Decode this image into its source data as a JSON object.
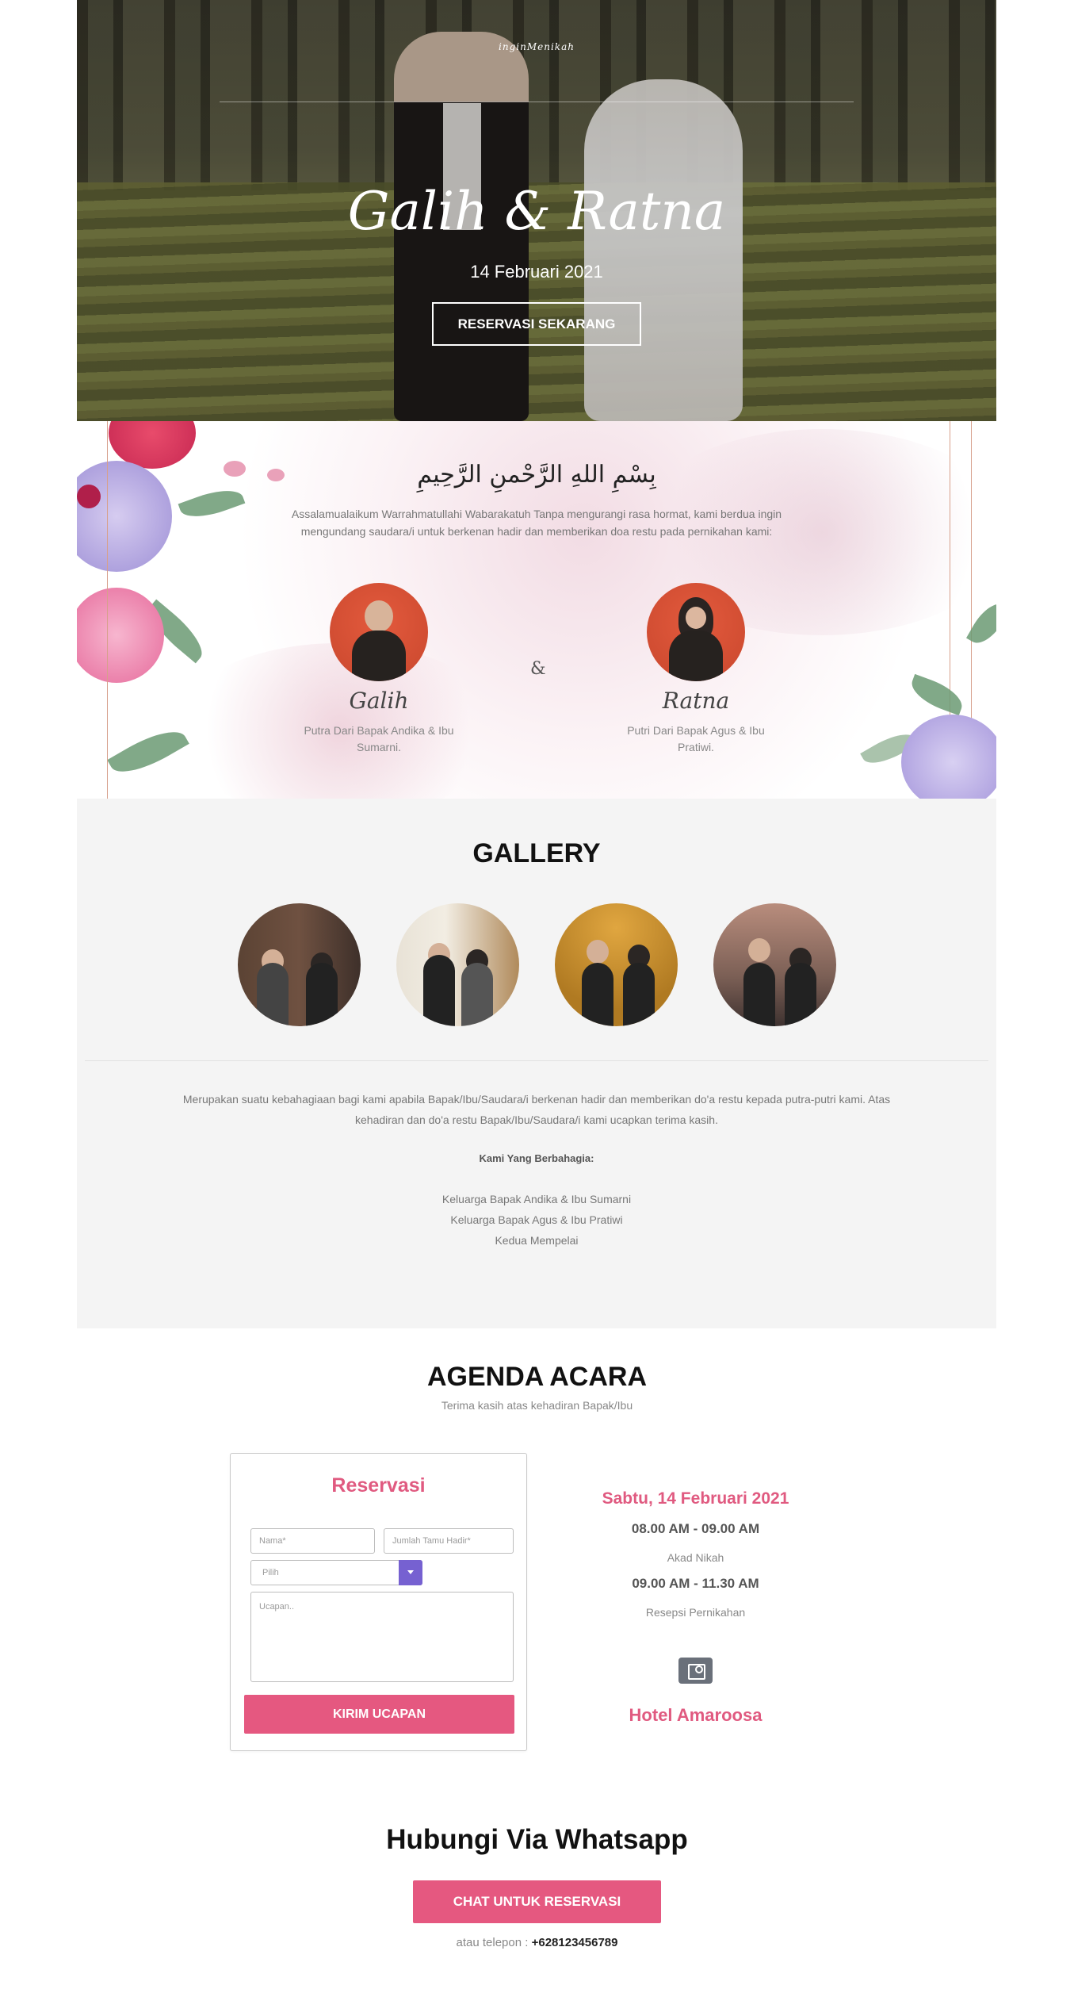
{
  "hero": {
    "logo": "inginMenikah",
    "names": "Galih & Ratna",
    "date": "14 Februari 2021",
    "cta": "RESERVASI SEKARANG"
  },
  "intro": {
    "bismillah": "بِسْمِ اللهِ الرَّحْمنِ الرَّحِيمِ",
    "greeting": "Assalamualaikum Warrahmatullahi Wabarakatuh Tanpa mengurangi rasa hormat, kami berdua ingin mengundang saudara/i untuk berkenan hadir dan memberikan doa restu pada pernikahan kami:",
    "amp": "&",
    "groom": {
      "name": "Galih",
      "desc": "Putra Dari Bapak Andika & Ibu Sumarni."
    },
    "bride": {
      "name": "Ratna",
      "desc": "Putri Dari Bapak Agus & Ibu Pratiwi."
    }
  },
  "gallery": {
    "title": "GALLERY",
    "message": "Merupakan suatu kebahagiaan bagi kami apabila Bapak/Ibu/Saudara/i berkenan hadir dan memberikan do'a restu kepada putra-putri kami. Atas kehadiran dan do'a restu Bapak/Ibu/Saudara/i kami ucapkan terima kasih.",
    "sign_title": "Kami Yang Berbahagia:",
    "signers": [
      "Keluarga Bapak Andika & Ibu Sumarni",
      "Keluarga Bapak Agus & Ibu Pratiwi",
      "Kedua Mempelai"
    ]
  },
  "agenda": {
    "title": "AGENDA ACARA",
    "subtitle": "Terima kasih atas kehadiran Bapak/Ibu",
    "form": {
      "title": "Reservasi",
      "name_placeholder": "Nama*",
      "guests_placeholder": "Jumlah Tamu Hadir*",
      "select_value": "Pilih",
      "message_placeholder": "Ucapan..",
      "submit": "KIRIM UCAPAN"
    },
    "event_date": "Sabtu, 14 Februari 2021",
    "events": [
      {
        "time": "08.00 AM - 09.00 AM",
        "name": "Akad Nikah"
      },
      {
        "time": "09.00 AM - 11.30 AM",
        "name": "Resepsi Pernikahan"
      }
    ],
    "map_icon": "map-icon",
    "venue": "Hotel Amaroosa"
  },
  "contact": {
    "title": "Hubungi Via Whatsapp",
    "button": "CHAT UNTUK RESERVASI",
    "phone_label": "atau telepon :",
    "phone": "+628123456789"
  },
  "colors": {
    "accent": "#e55880",
    "select": "#7661d1"
  }
}
